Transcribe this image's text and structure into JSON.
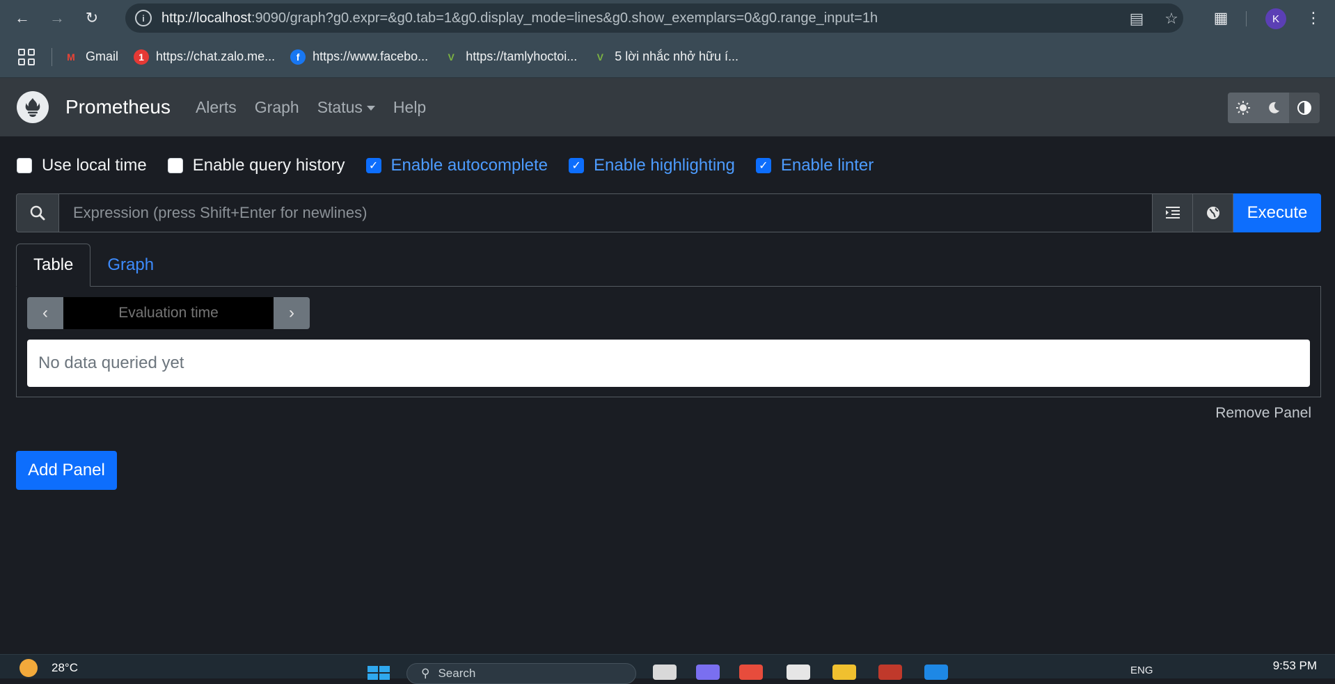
{
  "browser": {
    "url_host": "http://localhost",
    "url_rest": ":9090/graph?g0.expr=&g0.tab=1&g0.display_mode=lines&g0.show_exemplars=0&g0.range_input=1h",
    "profile_initial": "K",
    "bookmarks": [
      {
        "label": "Gmail",
        "icon": "gmail-icon",
        "color": "#ea4335"
      },
      {
        "label": "https://chat.zalo.me...",
        "icon": "zalo-icon",
        "color": "#e53935"
      },
      {
        "label": "https://www.facebo...",
        "icon": "facebook-icon",
        "color": "#1877f2"
      },
      {
        "label": "https://tamlyhoctoi...",
        "icon": "site-icon",
        "color": "#7cb342"
      },
      {
        "label": "5 lời nhắc nhở hữu í...",
        "icon": "site-icon",
        "color": "#7cb342"
      }
    ]
  },
  "navbar": {
    "brand": "Prometheus",
    "links": [
      "Alerts",
      "Graph",
      "Status",
      "Help"
    ]
  },
  "options": [
    {
      "label": "Use local time",
      "checked": false
    },
    {
      "label": "Enable query history",
      "checked": false
    },
    {
      "label": "Enable autocomplete",
      "checked": true
    },
    {
      "label": "Enable highlighting",
      "checked": true
    },
    {
      "label": "Enable linter",
      "checked": true
    }
  ],
  "expression": {
    "placeholder": "Expression (press Shift+Enter for newlines)",
    "value": "",
    "execute_label": "Execute"
  },
  "panel": {
    "tabs": [
      "Table",
      "Graph"
    ],
    "active_tab": "Table",
    "eval_placeholder": "Evaluation time",
    "no_data_text": "No data queried yet",
    "remove_label": "Remove Panel"
  },
  "add_panel_label": "Add Panel",
  "colors": {
    "accent": "#0d6efd",
    "link": "#3d8bfd",
    "background": "#1a1d23",
    "navbar": "#343a40"
  },
  "taskbar": {
    "temperature": "28°C",
    "search_placeholder": "Search",
    "language": "ENG",
    "clock": "9:53 PM"
  }
}
